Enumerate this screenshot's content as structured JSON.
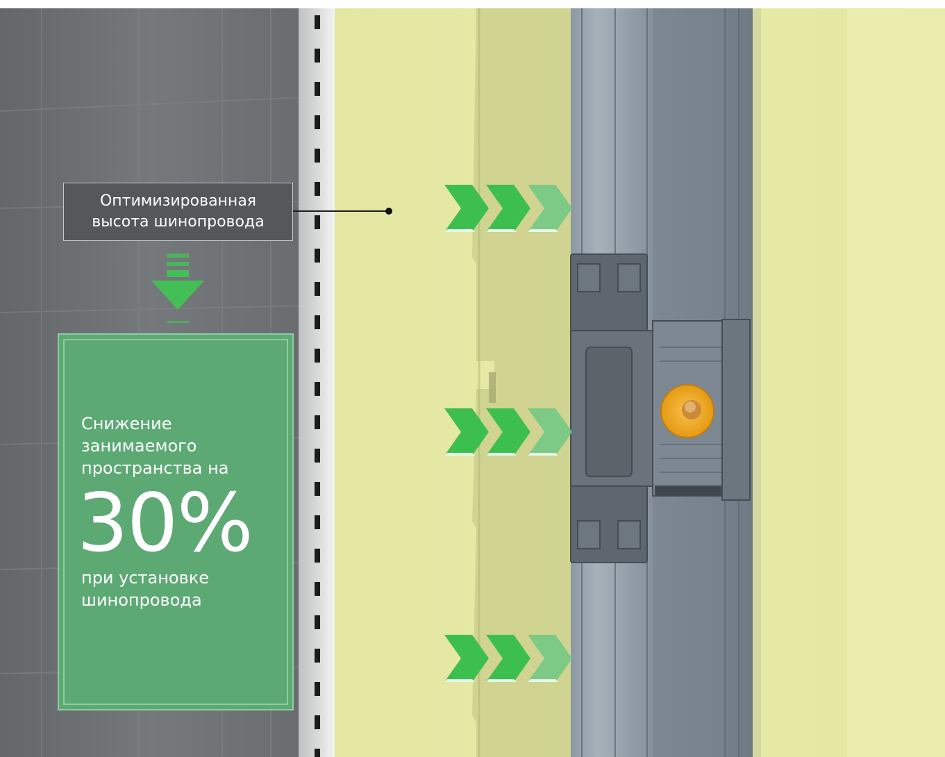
{
  "callout": {
    "line1": "Оптимизированная",
    "line2": "высота шинопровода"
  },
  "stat": {
    "lead_line1": "Снижение",
    "lead_line2": "занимаемого",
    "lead_line3": "пространства на",
    "value": "30%",
    "tail_line1": "при установке",
    "tail_line2": "шинопровода"
  },
  "colors": {
    "panel_green": "#5ca974",
    "arrow_green": "#3dbf4f",
    "wall_yellow": "#e6e9a2",
    "busbar_grey": "#7f8d99",
    "bolt_orange": "#f0a51c",
    "callout_grey": "#555759"
  },
  "icons": [
    "push-chevrons-icon",
    "down-arrow-icon",
    "bolt-icon"
  ]
}
